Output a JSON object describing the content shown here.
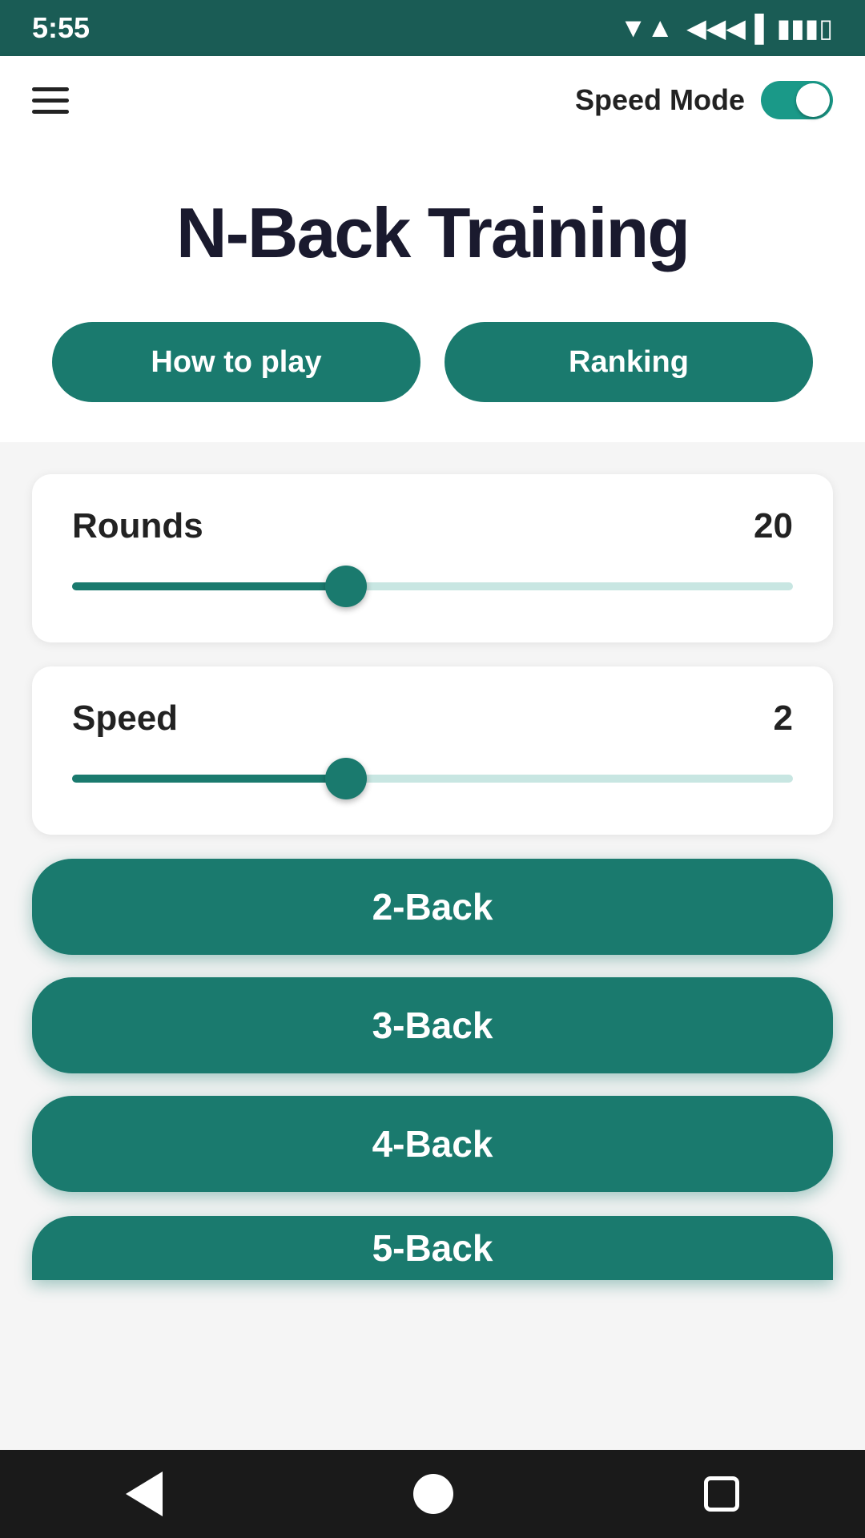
{
  "statusBar": {
    "time": "5:55",
    "wifi": "▼",
    "signal": "▲",
    "battery": "🔋"
  },
  "appBar": {
    "speedModeLabel": "Speed Mode",
    "toggleEnabled": true
  },
  "hero": {
    "title": "N-Back Training",
    "howToPlayLabel": "How to play",
    "rankingLabel": "Ranking"
  },
  "rounds": {
    "label": "Rounds",
    "value": "20",
    "min": 1,
    "max": 50,
    "current": 20,
    "fillPercent": 38
  },
  "speed": {
    "label": "Speed",
    "value": "2",
    "min": 1,
    "max": 10,
    "current": 2,
    "fillPercent": 38
  },
  "gameButtons": [
    {
      "label": "2-Back"
    },
    {
      "label": "3-Back"
    },
    {
      "label": "4-Back"
    },
    {
      "label": "5-Back"
    }
  ],
  "navBar": {
    "backLabel": "back",
    "homeLabel": "home",
    "recentLabel": "recent"
  }
}
